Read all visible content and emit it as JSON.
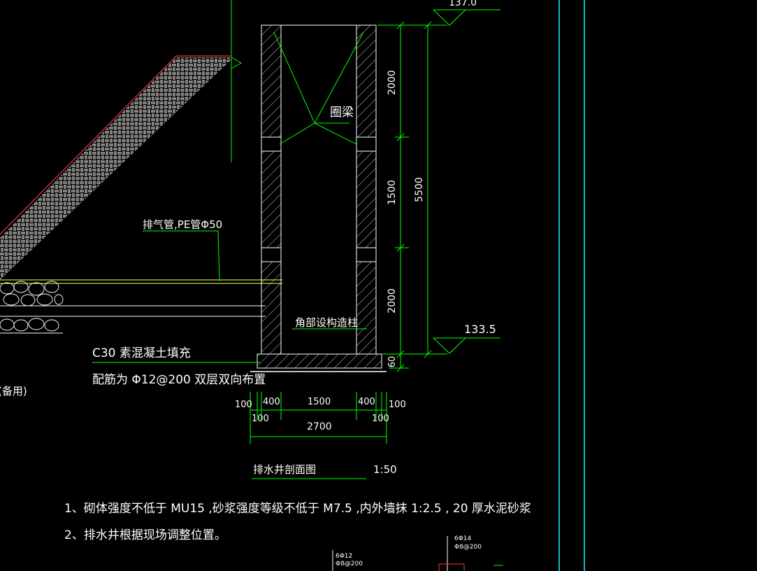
{
  "colors": {
    "background": "#000000",
    "structure": "#ffffff",
    "dimension": "#00ff00",
    "frame": "#00ffff",
    "pipe": "#ffff66",
    "edge": "#ff3333"
  },
  "labels": {
    "ring_beam": "圈梁",
    "vent_pipe": "排气管,PE管Φ50",
    "corner_column": "角部设构造柱",
    "fill_note": "C30 素混凝土填充",
    "rebar_note": "配筋为  Φ12@200  双层双向布置",
    "left_partial": "砂(备用)",
    "title": "排水井剖面图",
    "scale": "1:50",
    "elev_top": "137.0",
    "elev_bottom": "133.5",
    "side_label_1": "6Φ12",
    "side_label_2": "Φ8@200",
    "side_label_3": "6Φ14",
    "side_label_4": "Φ8@200"
  },
  "dimensions": {
    "vertical": [
      "2000",
      "1500",
      "2000",
      "60"
    ],
    "vertical_total": "5500",
    "horizontal_top": [
      "100",
      "400",
      "1500",
      "400",
      "100"
    ],
    "horizontal_small": [
      "100",
      "100"
    ],
    "horizontal_total": "2700"
  },
  "notes": [
    "1、砌体强度不低于      MU15  ,砂浆强度等级不低于          M7.5  ,内外墙抹    1:2.5  , 20 厚水泥砂浆",
    "2、排水井根据现场调整位置。"
  ]
}
